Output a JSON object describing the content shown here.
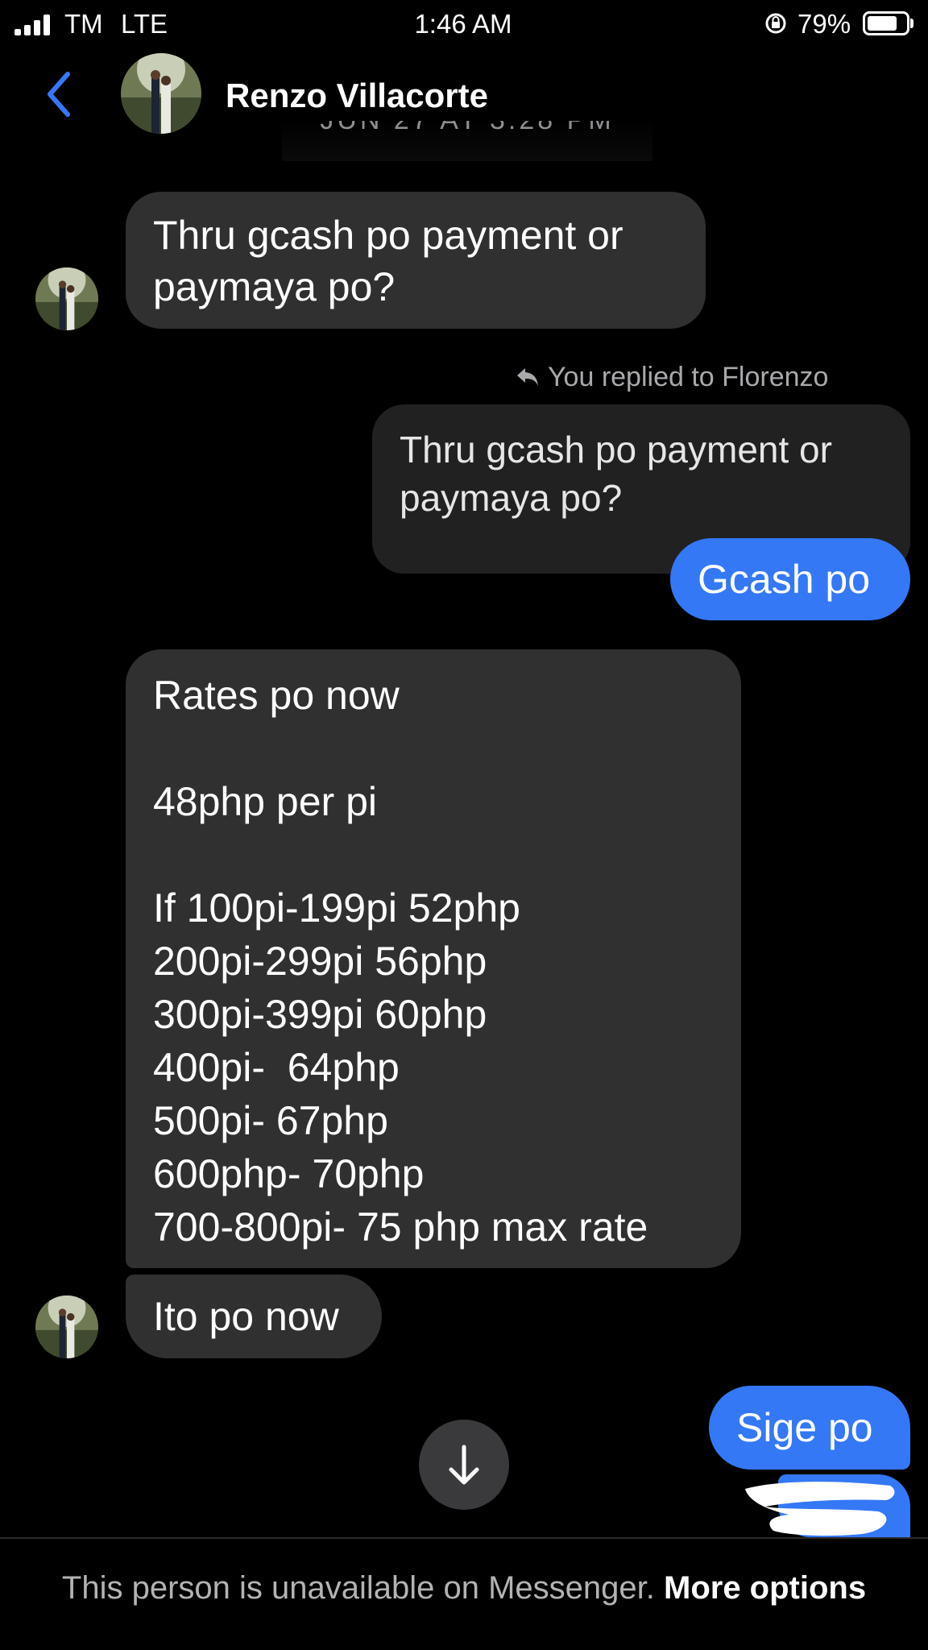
{
  "status_bar": {
    "carrier": "TM",
    "network": "LTE",
    "time": "1:46 AM",
    "battery": "79%",
    "battery_level": 0.79
  },
  "header": {
    "contact_name": "Renzo Villacorte",
    "date_divider": "JUN 27 AT 3:28 PM"
  },
  "messages": {
    "m1": "Thru gcash po payment or\npaymaya po?",
    "reply_label": "You replied to Florenzo",
    "quoted": "Thru gcash po payment or\npaymaya po?",
    "m2": "Gcash po",
    "m3": "Rates po now\n\n48php per pi\n\nIf 100pi-199pi 52php\n200pi-299pi 56php\n300pi-399pi 60php\n400pi-  64php\n500pi- 67php\n600php- 70php\n700-800pi- 75 php max rate",
    "m4": "Ito po now",
    "m5": "Sige po"
  },
  "footer": {
    "text": "This person is unavailable on Messenger. ",
    "link": "More options"
  },
  "colors": {
    "background": "#000000",
    "incoming_bubble": "#303030",
    "outgoing_bubble": "#3478f6",
    "back_accent": "#3478f6"
  },
  "icons": {
    "back": "chevron-left-icon",
    "reply": "reply-arrow-icon",
    "scroll_down": "arrow-down-icon",
    "orientation_lock": "orientation-lock-icon"
  }
}
